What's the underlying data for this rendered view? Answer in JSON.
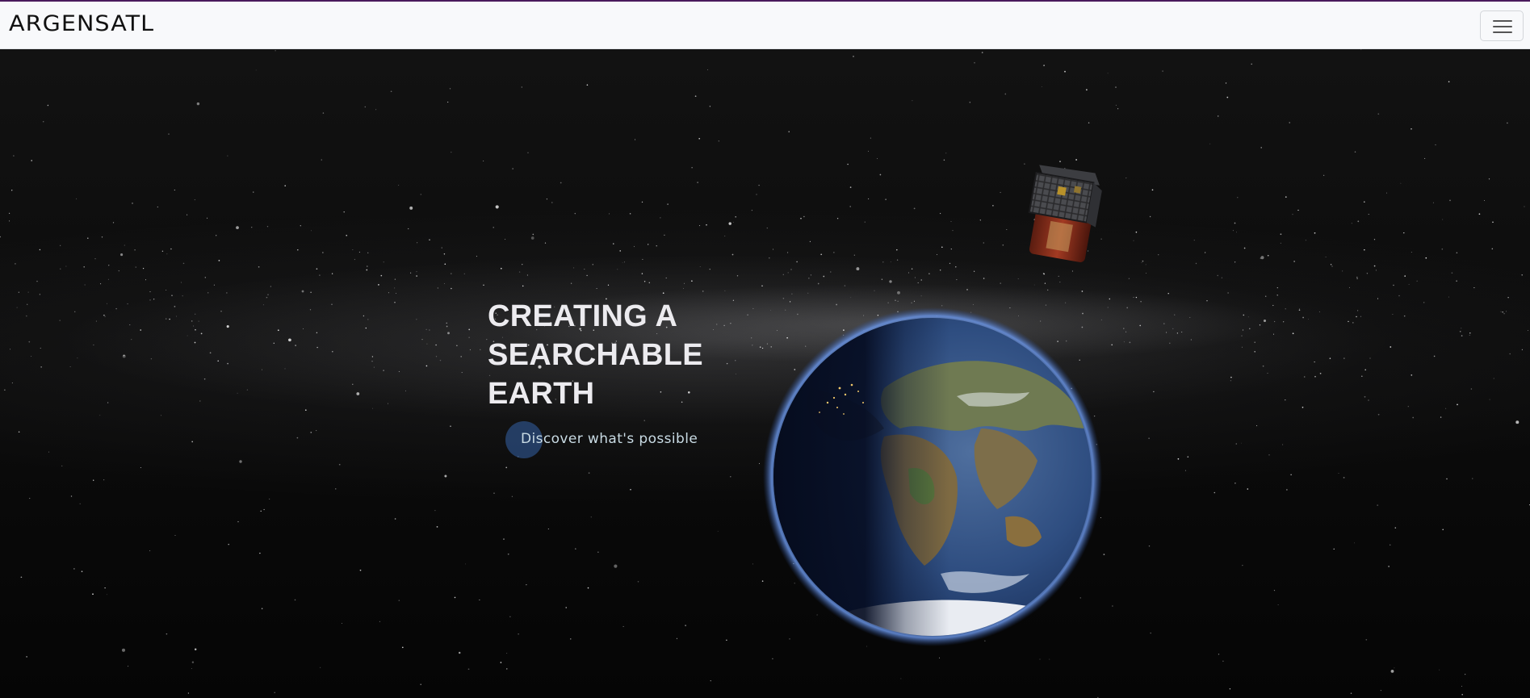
{
  "navbar": {
    "brand": "ARGENSATL",
    "menu_icon": "hamburger-menu-icon"
  },
  "hero": {
    "headline_lines": [
      "CREATING A",
      "SEARCHABLE",
      "EARTH"
    ],
    "cta_label": "Discover what's possible",
    "illustrations": [
      "satellite",
      "earth-globe"
    ]
  },
  "colors": {
    "navbar_bg": "#f8f9fb",
    "top_accent": "#4a1a5c",
    "hero_bg": "#0b0b0b",
    "headline": "#ecebef",
    "cta_text": "#c9dbe4",
    "cta_circle": "#305896",
    "earth_glow": "#4f7ed0"
  }
}
